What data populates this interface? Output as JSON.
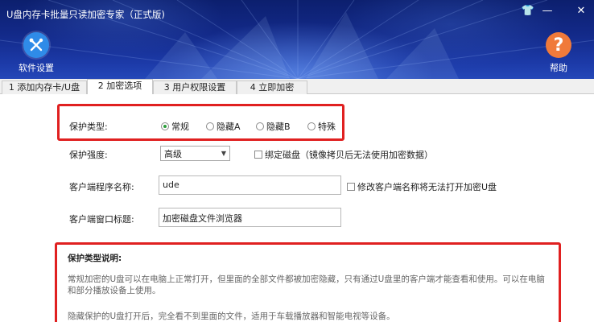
{
  "window": {
    "title": "U盘内存卡批量只读加密专家（正式版)",
    "controls": {
      "skin": "👕",
      "minimize": "—",
      "close": "✕"
    }
  },
  "toolbar": {
    "settings_label": "软件设置",
    "settings_icon": "wrench-screwdriver-icon",
    "help_label": "帮助",
    "help_icon": "question-icon",
    "help_glyph": "?"
  },
  "tabs": [
    {
      "label": "1 添加内存卡/U盘"
    },
    {
      "label": "2 加密选项"
    },
    {
      "label": "3 用户权限设置"
    },
    {
      "label": "4 立即加密"
    }
  ],
  "options": {
    "protect_type_label": "保护类型:",
    "protect_types": [
      "常规",
      "隐藏A",
      "隐藏B",
      "特殊"
    ],
    "protect_type_selected": "常规",
    "strength_label": "保护强度:",
    "strength_value": "高级",
    "bind_disk_label": "绑定磁盘（镜像拷贝后无法使用加密数据）",
    "client_name_label": "客户端程序名称:",
    "client_name_value": "ude",
    "modify_client_label": "修改客户端名称将无法打开加密U盘",
    "client_title_label": "客户端窗口标题:",
    "client_title_value": "加密磁盘文件浏览器"
  },
  "description": {
    "title": "保护类型说明:",
    "line1": "常规加密的U盘可以在电脑上正常打开，但里面的全部文件都被加密隐藏，只有通过U盘里的客户端才能查看和使用。可以在电脑",
    "line2": "和部分播放设备上使用。",
    "line3": "隐藏保护的U盘打开后，完全看不到里面的文件，适用于车载播放器和智能电视等设备。"
  },
  "colors": {
    "banner": "#132a8a",
    "highlight_border": "#e02020",
    "settings_circle": "#2f8be8",
    "help_circle": "#f07a3a",
    "radio_selected": "#2a9d3a"
  }
}
